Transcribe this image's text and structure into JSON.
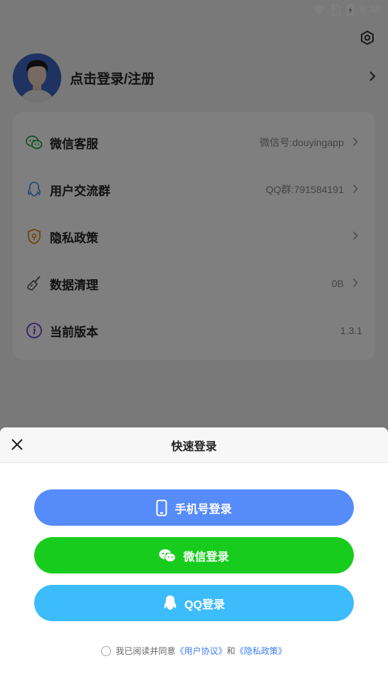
{
  "status_bar": {
    "time": "9:38",
    "icons": [
      "wifi-icon",
      "no-sim-icon",
      "battery-icon"
    ]
  },
  "profile": {
    "title": "点击登录/注册",
    "avatar": "avatar-icon"
  },
  "menu": [
    {
      "label": "微信客服",
      "value": "微信号:douyingapp",
      "icon": "wechat-icon",
      "icon_color": "#19a33a",
      "arrow": true
    },
    {
      "label": "用户交流群",
      "value": "QQ群:791584191",
      "icon": "qq-icon",
      "icon_color": "#3b8ee8",
      "arrow": true
    },
    {
      "label": "隐私政策",
      "value": "",
      "icon": "shield-icon",
      "icon_color": "#e08a1e",
      "arrow": true
    },
    {
      "label": "数据清理",
      "value": "0B",
      "icon": "broom-icon",
      "icon_color": "#555555",
      "arrow": true
    },
    {
      "label": "当前版本",
      "value": "1.3.1",
      "icon": "info-icon",
      "icon_color": "#6b3fd0",
      "arrow": false
    }
  ],
  "sheet": {
    "title": "快速登录",
    "buttons": {
      "phone": "手机号登录",
      "wechat": "微信登录",
      "qq": "QQ登录"
    },
    "agreement": {
      "prefix": "我已阅读并同意",
      "user_agreement": "《用户协议》",
      "and": "和",
      "privacy": "《隐私政策》"
    }
  },
  "colors": {
    "phone": "#568bfa",
    "wechat": "#17cc1c",
    "qq": "#3dbcfb",
    "link": "#3c7ef6"
  }
}
